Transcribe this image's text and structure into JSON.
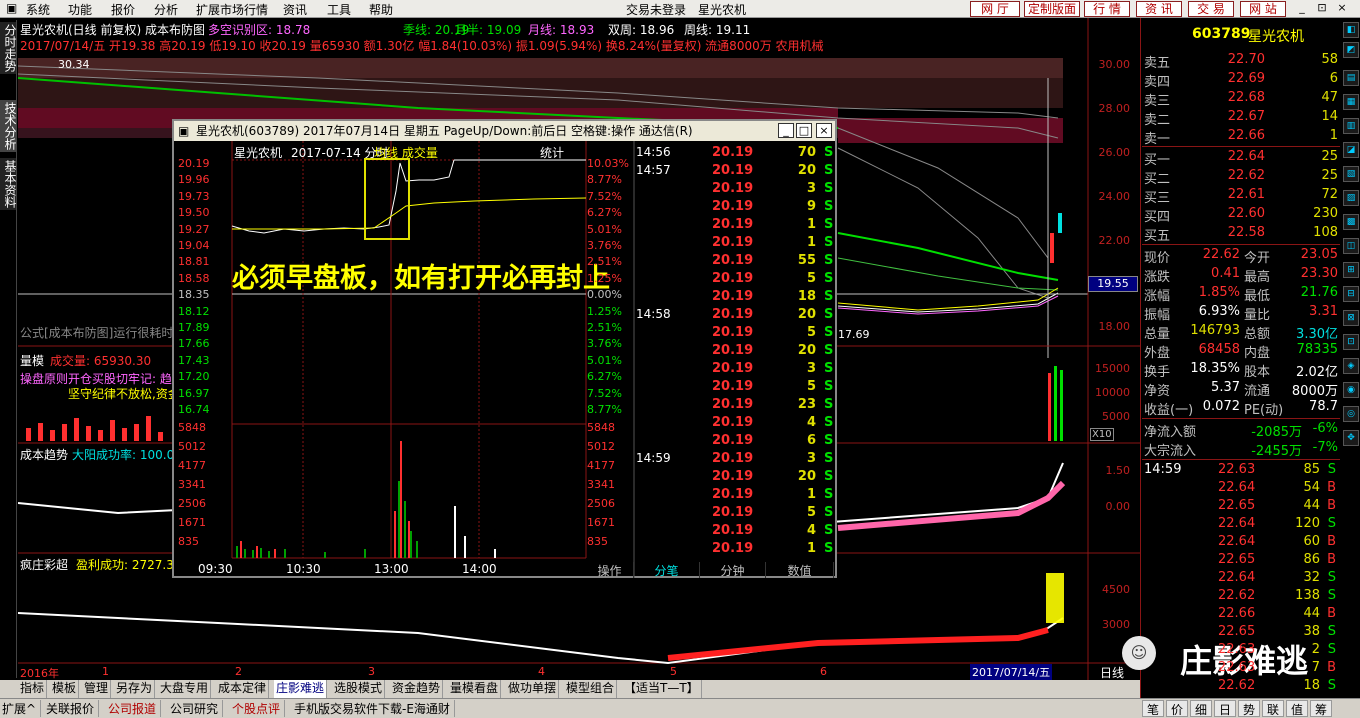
{
  "menubar": {
    "items": [
      "系统",
      "功能",
      "报价",
      "分析",
      "扩展市场行情",
      "资讯",
      "工具",
      "帮助"
    ],
    "trade_status": "交易未登录",
    "stock_name": "星光农机",
    "buttons": [
      "网 厅",
      "定制版面",
      "行 情",
      "资 讯",
      "交 易",
      "网 站"
    ],
    "win_controls": [
      "_",
      "⊡",
      "×"
    ]
  },
  "left_tabs": [
    "分时走势",
    "技术分析",
    "基本资料"
  ],
  "chart": {
    "title": "星光农机(日线 前复权) 成本布防图",
    "duo_label": "多空识别区: 18.78",
    "ma_lines": [
      {
        "label": "季线: 20.19",
        "color": "#00e000"
      },
      {
        "label": "月半: 19.09",
        "color": "#00e000"
      },
      {
        "label": "月线: 18.93",
        "color": "#ff66ff"
      },
      {
        "label": "双周: 18.96",
        "color": "#ffffff"
      },
      {
        "label": "周线: 19.11",
        "color": "#ffffff"
      }
    ],
    "info_line": "2017/07/14/五 开19.38 高20.19 低19.10 收20.19 量65930 额1.30亿 幅1.84(10.03%) 振1.09(5.94%) 换8.24%(量复权) 流通8000万 农用机械",
    "label_3034": "30.34",
    "label_1769": "17.69",
    "price_axis": [
      "30.00",
      "28.00",
      "26.00",
      "24.00",
      "22.00",
      "18.00"
    ],
    "current_price_tag": "19.55",
    "formula_note": "公式[成本布防图]运行很耗时",
    "vol_panel": {
      "title": "量模",
      "vol_label": "成交量: 65930.30",
      "axis": [
        "15000",
        "10000",
        "5000"
      ],
      "x10": "X10",
      "note1": "操盘原则开仓买股切牢记: 趋",
      "note2": "坚守纪律不放松,资金"
    },
    "trend_panel": {
      "title": "成本趋势",
      "sub": "大阳成功率: 100.00",
      "axis": [
        "1.50",
        "0.00"
      ]
    },
    "crazy_panel": {
      "title": "疯庄彩超",
      "sub": "盈利成功: 2727.38",
      "axis": [
        "4500",
        "3000"
      ]
    },
    "x_axis": [
      "2016年",
      "1",
      "2",
      "3",
      "4",
      "5",
      "6",
      "2017/07/14/五"
    ],
    "day_line": "日线",
    "zoom": [
      "+",
      "-",
      "0"
    ]
  },
  "popup": {
    "title": "星光农机(603789) 2017年07月14日 星期五 PageUp/Down:前后日 空格键:操作 通达信(R)",
    "header_name": "星光农机",
    "header_date": "2017-07-14 分时",
    "header_tag": "均线 成交量",
    "header_stat": "统计",
    "left_axis": [
      "20.19",
      "19.96",
      "19.73",
      "19.50",
      "19.27",
      "19.04",
      "18.81",
      "18.58",
      "18.35",
      "18.12",
      "17.89",
      "17.66",
      "17.43",
      "17.20",
      "16.97",
      "16.74",
      "5848",
      "5012",
      "4177",
      "3341",
      "2506",
      "1671",
      "835"
    ],
    "right_axis": [
      "10.03%",
      "8.77%",
      "7.52%",
      "6.27%",
      "5.01%",
      "3.76%",
      "2.51%",
      "1.25%",
      "0.00%",
      "1.25%",
      "2.51%",
      "3.76%",
      "5.01%",
      "6.27%",
      "7.52%",
      "8.77%",
      "5848",
      "5012",
      "4177",
      "3341",
      "2506",
      "1671",
      "835"
    ],
    "time_axis": [
      "09:30",
      "10:30",
      "13:00",
      "14:00"
    ],
    "overlay_text": "必须早盘板，如有打开必再封上",
    "ticks": [
      {
        "t": "14:56",
        "p": "20.19",
        "v": "70",
        "s": "S"
      },
      {
        "t": "14:57",
        "p": "20.19",
        "v": "20",
        "s": "S"
      },
      {
        "t": "",
        "p": "20.19",
        "v": "3",
        "s": "S"
      },
      {
        "t": "",
        "p": "20.19",
        "v": "9",
        "s": "S"
      },
      {
        "t": "",
        "p": "20.19",
        "v": "1",
        "s": "S"
      },
      {
        "t": "",
        "p": "20.19",
        "v": "1",
        "s": "S"
      },
      {
        "t": "",
        "p": "20.19",
        "v": "55",
        "s": "S"
      },
      {
        "t": "",
        "p": "20.19",
        "v": "5",
        "s": "S"
      },
      {
        "t": "",
        "p": "20.19",
        "v": "18",
        "s": "S"
      },
      {
        "t": "14:58",
        "p": "20.19",
        "v": "20",
        "s": "S"
      },
      {
        "t": "",
        "p": "20.19",
        "v": "5",
        "s": "S"
      },
      {
        "t": "",
        "p": "20.19",
        "v": "20",
        "s": "S"
      },
      {
        "t": "",
        "p": "20.19",
        "v": "3",
        "s": "S"
      },
      {
        "t": "",
        "p": "20.19",
        "v": "5",
        "s": "S"
      },
      {
        "t": "",
        "p": "20.19",
        "v": "23",
        "s": "S"
      },
      {
        "t": "",
        "p": "20.19",
        "v": "4",
        "s": "S"
      },
      {
        "t": "",
        "p": "20.19",
        "v": "6",
        "s": "S"
      },
      {
        "t": "14:59",
        "p": "20.19",
        "v": "3",
        "s": "S"
      },
      {
        "t": "",
        "p": "20.19",
        "v": "20",
        "s": "S"
      },
      {
        "t": "",
        "p": "20.19",
        "v": "1",
        "s": "S"
      },
      {
        "t": "",
        "p": "20.19",
        "v": "5",
        "s": "S"
      },
      {
        "t": "",
        "p": "20.19",
        "v": "4",
        "s": "S"
      },
      {
        "t": "",
        "p": "20.19",
        "v": "1",
        "s": "S"
      }
    ],
    "tabs": [
      "操作",
      "分笔",
      "分钟",
      "数值"
    ]
  },
  "right_panel": {
    "code": "603789",
    "name": "星光农机",
    "sells": [
      {
        "l": "卖五",
        "p": "22.70",
        "v": "58"
      },
      {
        "l": "卖四",
        "p": "22.69",
        "v": "6"
      },
      {
        "l": "卖三",
        "p": "22.68",
        "v": "47"
      },
      {
        "l": "卖二",
        "p": "22.67",
        "v": "14"
      },
      {
        "l": "卖一",
        "p": "22.66",
        "v": "1"
      }
    ],
    "buys": [
      {
        "l": "买一",
        "p": "22.64",
        "v": "25"
      },
      {
        "l": "买二",
        "p": "22.62",
        "v": "25"
      },
      {
        "l": "买三",
        "p": "22.61",
        "v": "72"
      },
      {
        "l": "买四",
        "p": "22.60",
        "v": "230"
      },
      {
        "l": "买五",
        "p": "22.58",
        "v": "108"
      }
    ],
    "stats": [
      {
        "l1": "现价",
        "v1": "22.62",
        "l2": "今开",
        "v2": "23.05",
        "c1": "red",
        "c2": "red"
      },
      {
        "l1": "涨跌",
        "v1": "0.41",
        "l2": "最高",
        "v2": "23.30",
        "c1": "red",
        "c2": "red"
      },
      {
        "l1": "涨幅",
        "v1": "1.85%",
        "l2": "最低",
        "v2": "21.76",
        "c1": "red",
        "c2": "green"
      },
      {
        "l1": "振幅",
        "v1": "6.93%",
        "l2": "量比",
        "v2": "3.31",
        "c1": "wht",
        "c2": "red"
      },
      {
        "l1": "总量",
        "v1": "146793",
        "l2": "总额",
        "v2": "3.30亿",
        "c1": "yel",
        "c2": "cyan"
      },
      {
        "l1": "外盘",
        "v1": "68458",
        "l2": "内盘",
        "v2": "78335",
        "c1": "red",
        "c2": "green"
      },
      {
        "l1": "换手",
        "v1": "18.35%",
        "l2": "股本",
        "v2": "2.02亿",
        "c1": "wht",
        "c2": "wht"
      },
      {
        "l1": "净资",
        "v1": "5.37",
        "l2": "流通",
        "v2": "8000万",
        "c1": "wht",
        "c2": "wht"
      },
      {
        "l1": "收益(一)",
        "v1": "0.072",
        "l2": "PE(动)",
        "v2": "78.7",
        "c1": "wht",
        "c2": "wht"
      }
    ],
    "flows": [
      {
        "l": "净流入额",
        "v": "-2085万",
        "p": "-6%"
      },
      {
        "l": "大宗流入",
        "v": "-2455万",
        "p": "-7%"
      }
    ],
    "trades": [
      {
        "t": "14:59",
        "p": "22.63",
        "v": "85",
        "s": "S"
      },
      {
        "t": "",
        "p": "22.64",
        "v": "54",
        "s": "B"
      },
      {
        "t": "",
        "p": "22.65",
        "v": "44",
        "s": "B"
      },
      {
        "t": "",
        "p": "22.64",
        "v": "120",
        "s": "S"
      },
      {
        "t": "",
        "p": "22.64",
        "v": "60",
        "s": "B"
      },
      {
        "t": "",
        "p": "22.65",
        "v": "86",
        "s": "B"
      },
      {
        "t": "",
        "p": "22.64",
        "v": "32",
        "s": "S"
      },
      {
        "t": "",
        "p": "22.62",
        "v": "138",
        "s": "S"
      },
      {
        "t": "",
        "p": "22.66",
        "v": "44",
        "s": "B"
      },
      {
        "t": "",
        "p": "22.65",
        "v": "38",
        "s": "S"
      },
      {
        "t": "",
        "p": "22.63",
        "v": "2",
        "s": "S"
      },
      {
        "t": "",
        "p": "22.63",
        "v": "7",
        "s": "B"
      },
      {
        "t": "",
        "p": "22.62",
        "v": "18",
        "s": "S"
      }
    ],
    "bottom_tabs": [
      "笔",
      "价",
      "细",
      "日",
      "势",
      "联",
      "值",
      "筹"
    ]
  },
  "bottombar": [
    "指标",
    "模板",
    "管理",
    "另存为",
    "大盘专用",
    "成本定律",
    "庄影难逃",
    "选股模式",
    "资金趋势",
    "量模看盘",
    "做功单摆",
    "模型组合",
    "【适当T—T】"
  ],
  "statusbar": [
    "扩展^",
    "关联报价",
    "公司报道",
    "公司研究",
    "个股点评",
    "手机版交易软件下载-E海通财"
  ],
  "watermark": "庄影难逃"
}
